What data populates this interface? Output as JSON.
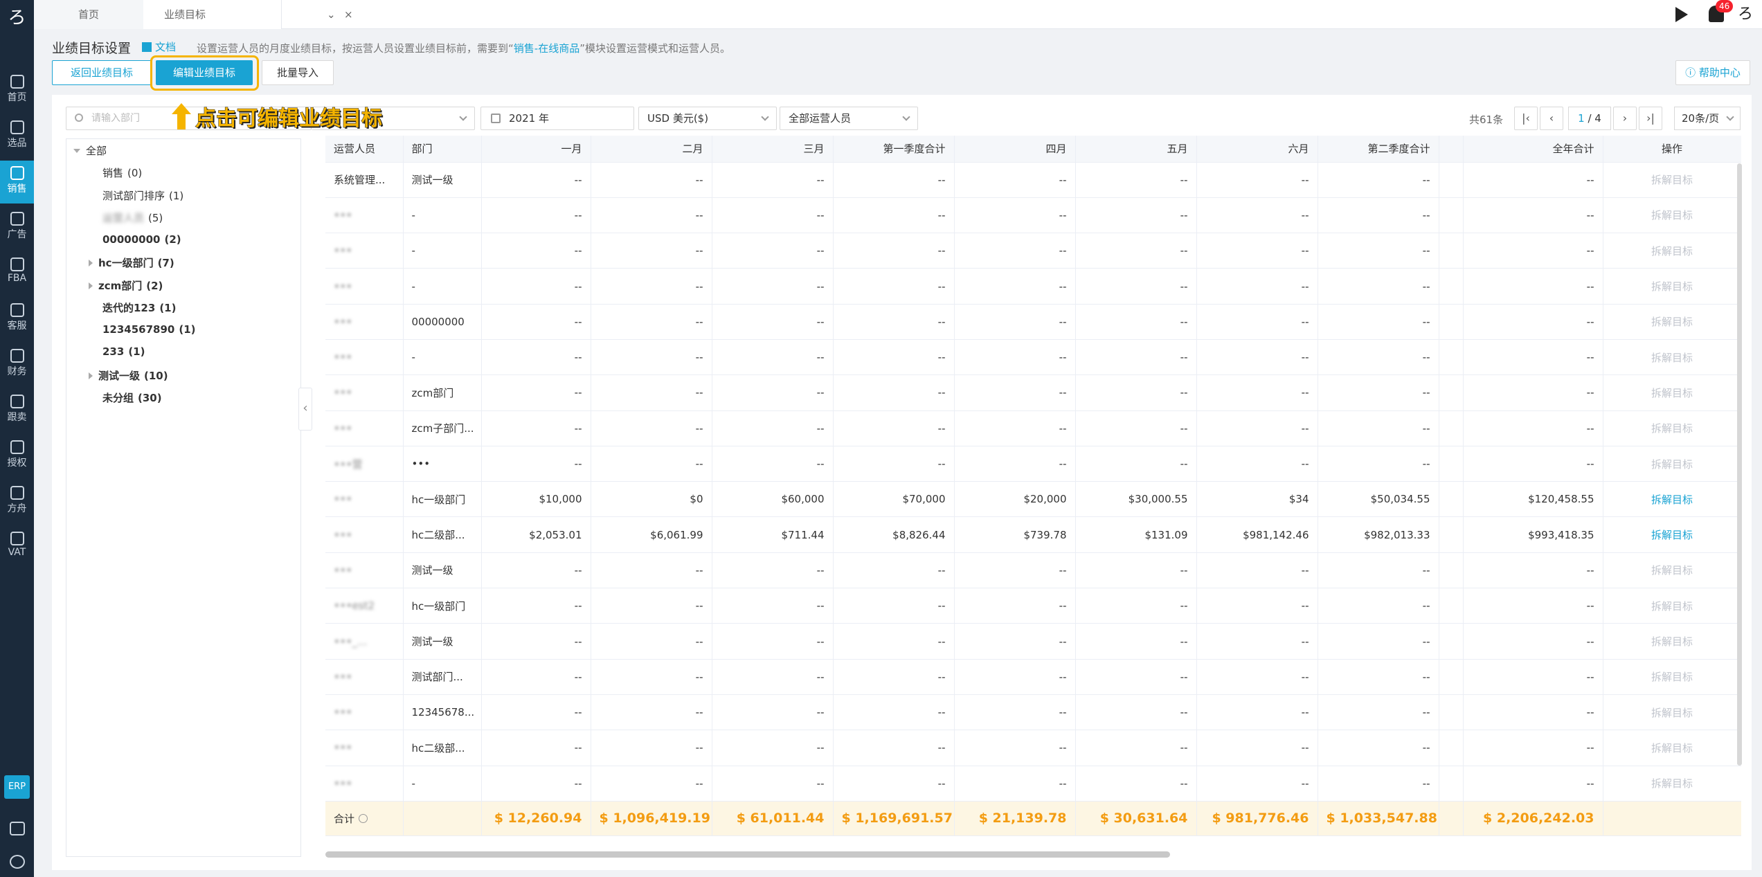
{
  "sidebar": {
    "items": [
      {
        "label": "首页",
        "icon": "home-icon"
      },
      {
        "label": "选品",
        "icon": "search-icon"
      },
      {
        "label": "销售",
        "icon": "chart-line-icon",
        "active": true
      },
      {
        "label": "广告",
        "icon": "ad-icon"
      },
      {
        "label": "FBA",
        "icon": "warehouse-icon"
      },
      {
        "label": "客服",
        "icon": "service-icon"
      },
      {
        "label": "财务",
        "icon": "dollar-icon"
      },
      {
        "label": "跟卖",
        "icon": "pie-icon"
      },
      {
        "label": "授权",
        "icon": "shield-icon"
      },
      {
        "label": "方舟",
        "icon": "ark-icon"
      },
      {
        "label": "VAT",
        "icon": "building-icon"
      }
    ],
    "erp_label": "ERP"
  },
  "tabs": {
    "home": "首页",
    "current": "业绩目标"
  },
  "notifications": {
    "count": "46"
  },
  "header": {
    "title": "业绩目标设置",
    "doc_link": "文档",
    "hint_prefix": "设置运营人员的月度业绩目标，按运营人员设置业绩目标前，需要到“",
    "hint_link": "销售-在线商品",
    "hint_suffix": "”模块设置运营模式和运营人员。"
  },
  "buttons": {
    "back": "返回业绩目标",
    "edit": "编辑业绩目标",
    "import": "批量导入",
    "help": "帮助中心"
  },
  "annotation": "点击可编辑业绩目标",
  "filters": {
    "dept_placeholder": "请输入部门",
    "year": "2021 年",
    "currency": "USD  美元($)",
    "operators": "全部运营人员"
  },
  "pagination": {
    "total": "共61条",
    "current": "1",
    "pages": "/ 4",
    "page_size": "20条/页"
  },
  "tree": {
    "root": "全部",
    "nodes": [
      {
        "label": "销售",
        "count": "(0)",
        "bold": false,
        "expandable": false,
        "blurred": false
      },
      {
        "label": "测试部门排序",
        "count": "(1)",
        "bold": false,
        "expandable": false,
        "blurred": false
      },
      {
        "label": "运营人员",
        "count": "(5)",
        "bold": false,
        "expandable": false,
        "blurred": true
      },
      {
        "label": "00000000",
        "count": "(2)",
        "bold": true,
        "expandable": false,
        "blurred": false
      },
      {
        "label": "hc一级部门",
        "count": "(7)",
        "bold": true,
        "expandable": true,
        "blurred": false
      },
      {
        "label": "zcm部门",
        "count": "(2)",
        "bold": true,
        "expandable": true,
        "blurred": false
      },
      {
        "label": "迭代的123",
        "count": "(1)",
        "bold": true,
        "expandable": false,
        "blurred": false
      },
      {
        "label": "1234567890",
        "count": "(1)",
        "bold": true,
        "expandable": false,
        "blurred": false
      },
      {
        "label": "233",
        "count": "(1)",
        "bold": true,
        "expandable": false,
        "blurred": false
      },
      {
        "label": "测试一级",
        "count": "(10)",
        "bold": true,
        "expandable": true,
        "blurred": false
      },
      {
        "label": "未分组",
        "count": "(30)",
        "bold": true,
        "expandable": false,
        "blurred": false
      }
    ]
  },
  "table": {
    "headers": [
      "运营人员",
      "部门",
      "一月",
      "二月",
      "三月",
      "第一季度合计",
      "四月",
      "五月",
      "六月",
      "第二季度合计",
      "",
      "全年合计",
      "操作"
    ],
    "rows": [
      [
        "系统管理...",
        "测试一级",
        "--",
        "--",
        "--",
        "--",
        "--",
        "--",
        "--",
        "--",
        "",
        "--",
        "拆解目标"
      ],
      [
        "•••",
        "-",
        "--",
        "--",
        "--",
        "--",
        "--",
        "--",
        "--",
        "--",
        "",
        "--",
        "拆解目标"
      ],
      [
        "•••",
        "-",
        "--",
        "--",
        "--",
        "--",
        "--",
        "--",
        "--",
        "--",
        "",
        "--",
        "拆解目标"
      ],
      [
        "•••",
        "-",
        "--",
        "--",
        "--",
        "--",
        "--",
        "--",
        "--",
        "--",
        "",
        "--",
        "拆解目标"
      ],
      [
        "•••",
        "00000000",
        "--",
        "--",
        "--",
        "--",
        "--",
        "--",
        "--",
        "--",
        "",
        "--",
        "拆解目标"
      ],
      [
        "•••",
        "-",
        "--",
        "--",
        "--",
        "--",
        "--",
        "--",
        "--",
        "--",
        "",
        "--",
        "拆解目标"
      ],
      [
        "•••",
        "zcm部门",
        "--",
        "--",
        "--",
        "--",
        "--",
        "--",
        "--",
        "--",
        "",
        "--",
        "拆解目标"
      ],
      [
        "•••",
        "zcm子部门...",
        "--",
        "--",
        "--",
        "--",
        "--",
        "--",
        "--",
        "--",
        "",
        "--",
        "拆解目标"
      ],
      [
        "•••营",
        "•••",
        "--",
        "--",
        "--",
        "--",
        "--",
        "--",
        "--",
        "--",
        "",
        "--",
        "拆解目标"
      ],
      [
        "•••",
        "hc一级部门",
        "$10,000",
        "$0",
        "$60,000",
        "$70,000",
        "$20,000",
        "$30,000.55",
        "$34",
        "$50,034.55",
        "",
        "$120,458.55",
        "拆解目标"
      ],
      [
        "•••",
        "hc二级部...",
        "$2,053.01",
        "$6,061.99",
        "$711.44",
        "$8,826.44",
        "$739.78",
        "$131.09",
        "$981,142.46",
        "$982,013.33",
        "",
        "$993,418.35",
        "拆解目标"
      ],
      [
        "•••",
        "测试一级",
        "--",
        "--",
        "--",
        "--",
        "--",
        "--",
        "--",
        "--",
        "",
        "--",
        "拆解目标"
      ],
      [
        "•••est2",
        "hc一级部门",
        "--",
        "--",
        "--",
        "--",
        "--",
        "--",
        "--",
        "--",
        "",
        "--",
        "拆解目标"
      ],
      [
        "•••_...",
        "测试一级",
        "--",
        "--",
        "--",
        "--",
        "--",
        "--",
        "--",
        "--",
        "",
        "--",
        "拆解目标"
      ],
      [
        "•••",
        "测试部门...",
        "--",
        "--",
        "--",
        "--",
        "--",
        "--",
        "--",
        "--",
        "",
        "--",
        "拆解目标"
      ],
      [
        "•••",
        "12345678...",
        "--",
        "--",
        "--",
        "--",
        "--",
        "--",
        "--",
        "--",
        "",
        "--",
        "拆解目标"
      ],
      [
        "•••",
        "hc二级部...",
        "--",
        "--",
        "--",
        "--",
        "--",
        "--",
        "--",
        "--",
        "",
        "--",
        "拆解目标"
      ],
      [
        "•••",
        "-",
        "--",
        "--",
        "--",
        "--",
        "--",
        "--",
        "--",
        "--",
        "",
        "--",
        "拆解目标"
      ]
    ],
    "active_rows": [
      9,
      10
    ],
    "summary": {
      "label": "合计",
      "values": [
        "$ 12,260.94",
        "$ 1,096,419.19",
        "$ 61,011.44",
        "$ 1,169,691.57",
        "$ 21,139.78",
        "$ 30,631.64",
        "$ 981,776.46",
        "$ 1,033,547.88",
        "",
        "$ 2,206,242.03",
        ""
      ]
    }
  },
  "colors": {
    "accent": "#1aa3d3",
    "sidebar_bg": "#1b2a3b",
    "highlight": "#f5b400",
    "summary_text": "#f39c12"
  }
}
